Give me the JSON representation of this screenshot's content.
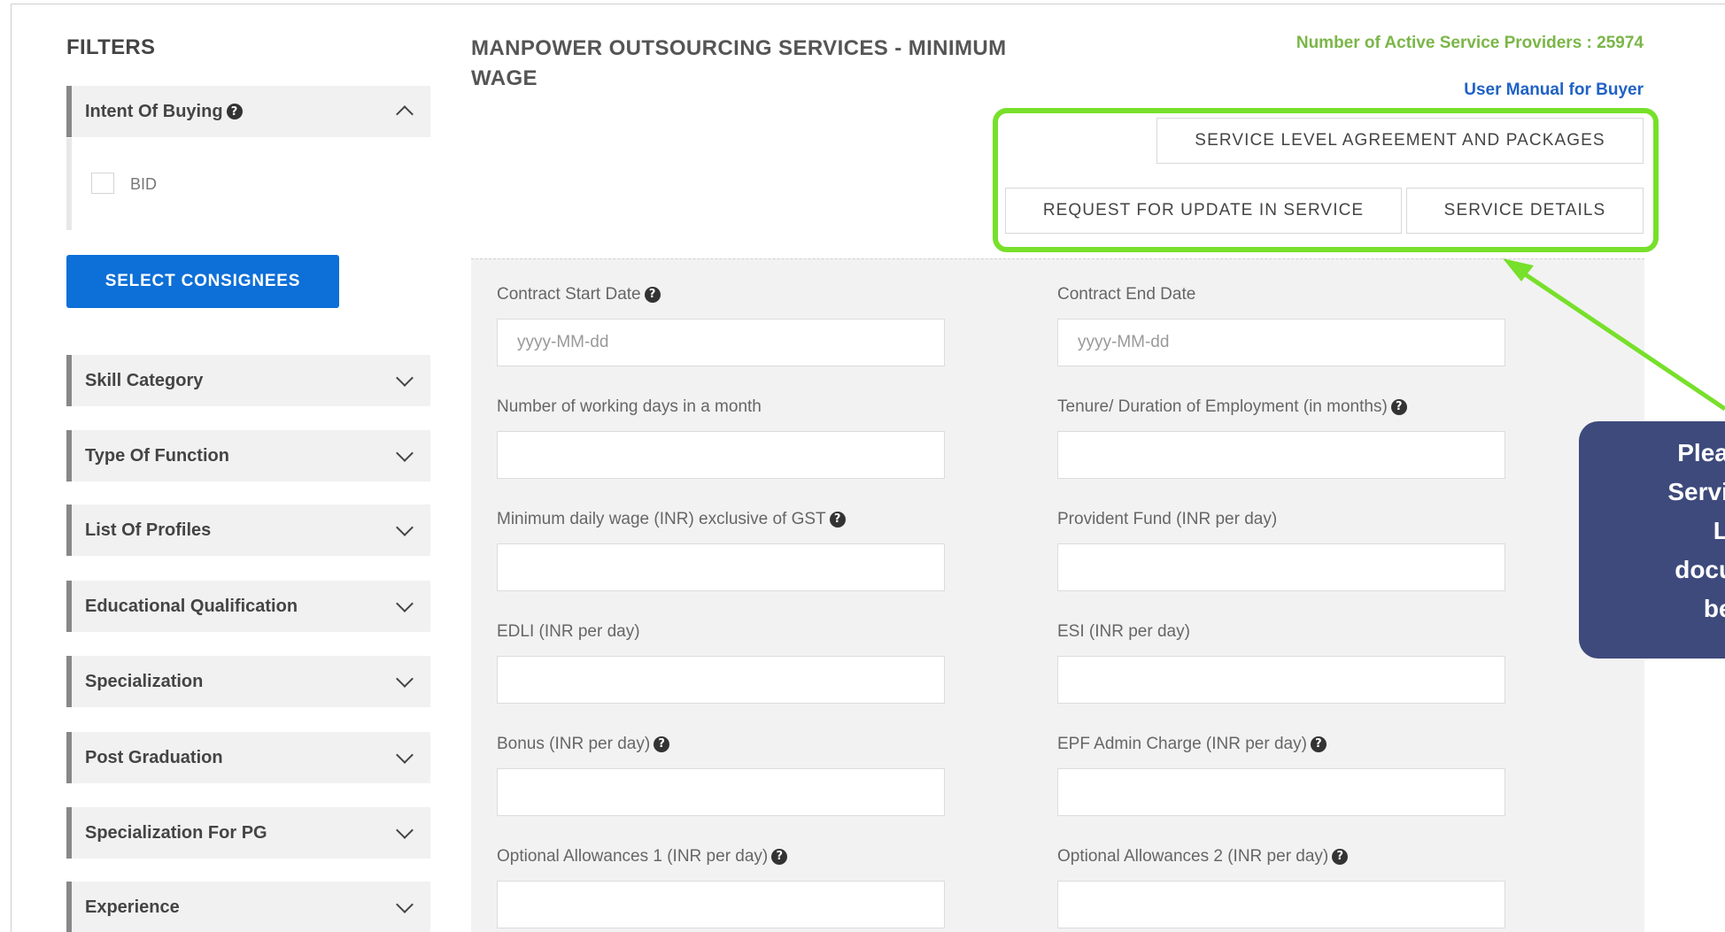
{
  "sidebar": {
    "title": "FILTERS",
    "intent": {
      "label": "Intent Of Buying",
      "option": "BID"
    },
    "select_consignees": "SELECT CONSIGNEES",
    "filters": [
      "Skill Category",
      "Type Of Function",
      "List Of Profiles",
      "Educational Qualification",
      "Specialization",
      "Post Graduation",
      "Specialization For PG",
      "Experience"
    ]
  },
  "main": {
    "title": "MANPOWER OUTSOURCING SERVICES - MINIMUM WAGE",
    "providers": "Number of Active Service Providers : 25974",
    "user_manual": "User Manual for Buyer",
    "buttons": {
      "sla": "SERVICE LEVEL AGREEMENT AND PACKAGES",
      "request_update": "REQUEST FOR UPDATE IN SERVICE",
      "service_details": "SERVICE DETAILS"
    },
    "fields": {
      "contract_start": {
        "label": "Contract Start Date",
        "placeholder": "yyyy-MM-dd"
      },
      "contract_end": {
        "label": "Contract End Date",
        "placeholder": "yyyy-MM-dd"
      },
      "working_days": {
        "label": "Number of working days in a month"
      },
      "tenure": {
        "label": "Tenure/ Duration of Employment (in months)"
      },
      "min_wage": {
        "label": "Minimum daily wage (INR) exclusive of GST"
      },
      "pf": {
        "label": "Provident Fund (INR per day)"
      },
      "edli": {
        "label": "EDLI (INR per day)"
      },
      "esi": {
        "label": "ESI (INR per day)"
      },
      "bonus": {
        "label": "Bonus (INR per day)"
      },
      "epf_admin": {
        "label": "EPF Admin Charge (INR per day)"
      },
      "opt1": {
        "label": "Optional Allowances 1 (INR per day)"
      },
      "opt2": {
        "label": "Optional Allowances 2 (INR per day)"
      }
    }
  },
  "callout": {
    "lines": [
      "Please",
      "Service",
      "Lev",
      "docum",
      "befo"
    ]
  },
  "colors": {
    "primary_button": "#0d6fd8",
    "highlight_border": "#77e02a",
    "providers_text": "#7ab648",
    "manual_link": "#1f62c4",
    "callout_bg": "#3e4a7c"
  }
}
